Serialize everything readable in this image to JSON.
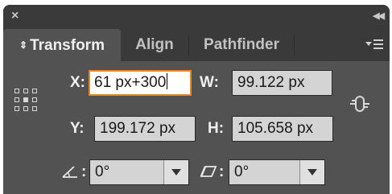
{
  "window": {
    "close_icon": "close-icon",
    "collapse_icon": "double-chevron-icon"
  },
  "tabs": [
    {
      "label": "Transform",
      "active": true,
      "icon": "up-down-arrows-icon"
    },
    {
      "label": "Align",
      "active": false
    },
    {
      "label": "Pathfinder",
      "active": false
    }
  ],
  "panel_menu_icon": "panel-menu-icon",
  "reference_point_icon": "reference-point-grid-icon",
  "fields": {
    "x": {
      "label": "X:",
      "value": "61 px+300",
      "focused": true
    },
    "w": {
      "label": "W:",
      "value": "99.122 px"
    },
    "y": {
      "label": "Y:",
      "value": "199.172 px"
    },
    "h": {
      "label": "H:",
      "value": "105.658 px"
    }
  },
  "constrain_icon": "link-proportions-icon",
  "rotate": {
    "label": ":",
    "icon": "rotate-angle-icon",
    "value": "0°"
  },
  "shear": {
    "label": ":",
    "icon": "shear-icon",
    "value": "0°"
  },
  "colors": {
    "accent_focus": "#e08a2c",
    "panel_bg": "#525252",
    "tab_bar_bg": "#3a3a3a"
  }
}
